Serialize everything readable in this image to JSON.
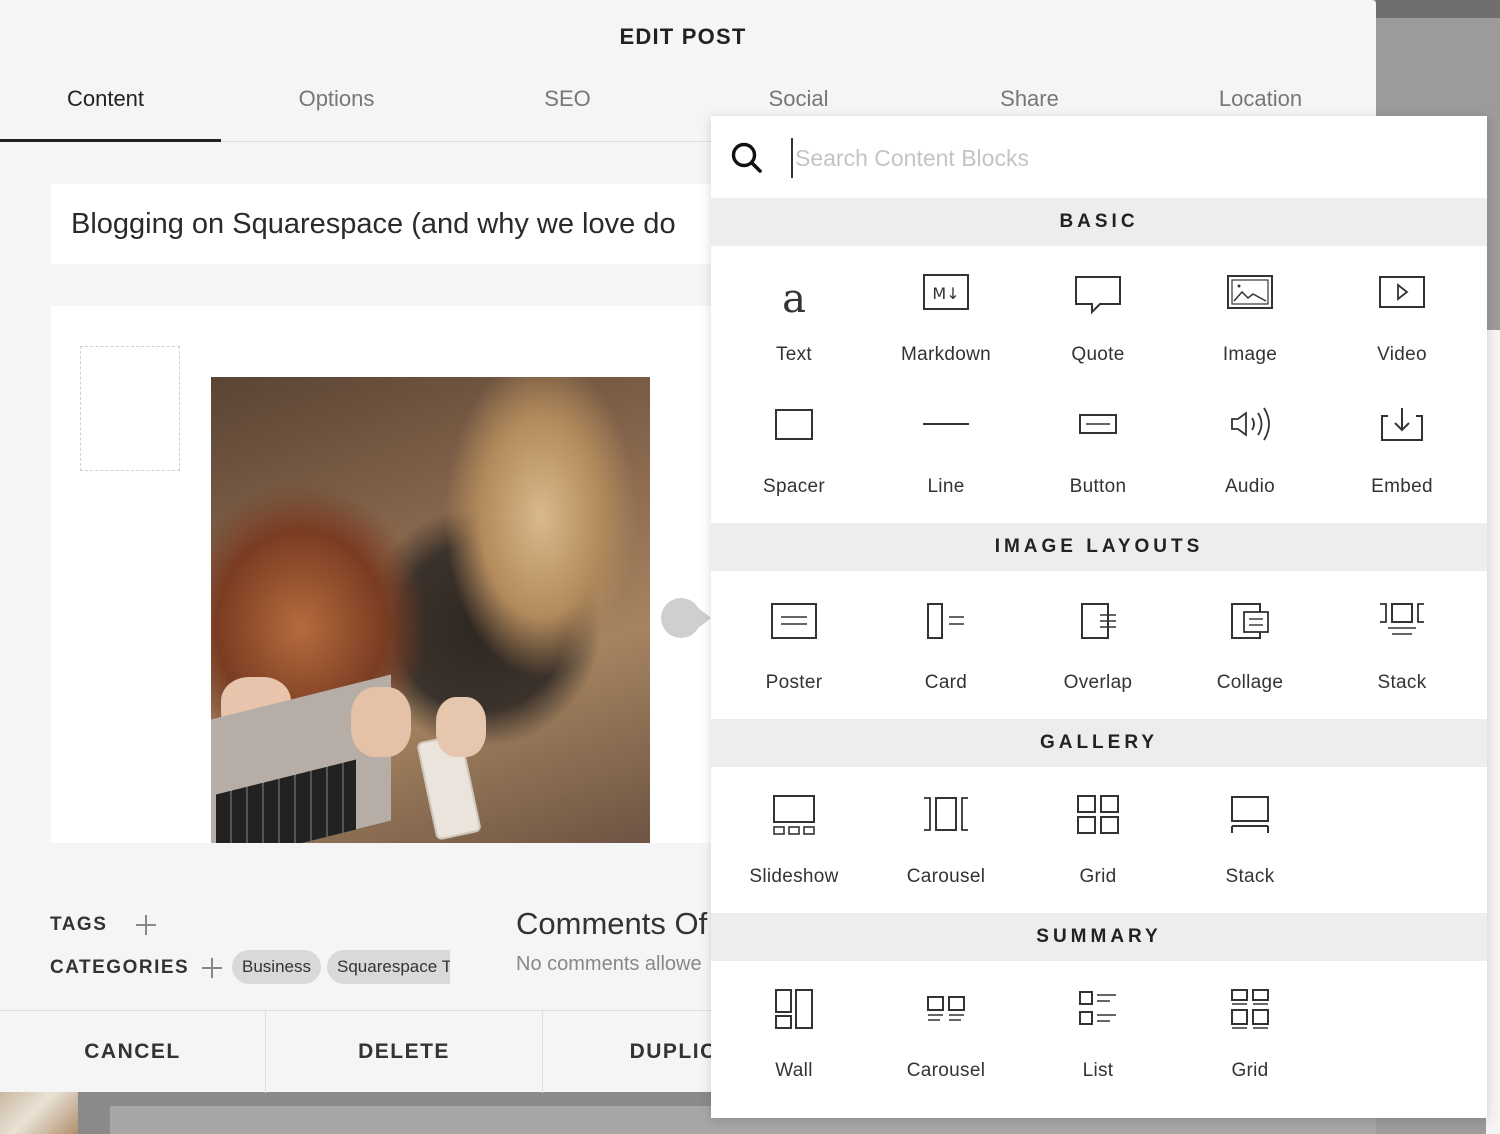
{
  "modal": {
    "title": "EDIT POST",
    "tabs": [
      {
        "label": "Content"
      },
      {
        "label": "Options"
      },
      {
        "label": "SEO"
      },
      {
        "label": "Social"
      },
      {
        "label": "Share"
      },
      {
        "label": "Location"
      }
    ],
    "active_tab": "Content",
    "post_title": "Blogging on Squarespace (and why we love do",
    "tags_label": "TAGS",
    "categories_label": "CATEGORIES",
    "categories": [
      "Business",
      "Squarespace T"
    ],
    "comments_title": "Comments Of",
    "comments_sub": "No comments allowe",
    "footer": {
      "cancel": "CANCEL",
      "delete": "DELETE",
      "duplicate": "DUPLICA"
    }
  },
  "panel": {
    "search_placeholder": "Search Content Blocks",
    "sections": [
      {
        "title": "BASIC",
        "blocks": [
          {
            "label": "Text",
            "icon": "text-icon"
          },
          {
            "label": "Markdown",
            "icon": "markdown-icon"
          },
          {
            "label": "Quote",
            "icon": "quote-icon"
          },
          {
            "label": "Image",
            "icon": "image-icon"
          },
          {
            "label": "Video",
            "icon": "video-icon"
          },
          {
            "label": "Spacer",
            "icon": "spacer-icon"
          },
          {
            "label": "Line",
            "icon": "line-icon"
          },
          {
            "label": "Button",
            "icon": "button-icon"
          },
          {
            "label": "Audio",
            "icon": "audio-icon"
          },
          {
            "label": "Embed",
            "icon": "embed-icon"
          }
        ]
      },
      {
        "title": "IMAGE LAYOUTS",
        "blocks": [
          {
            "label": "Poster",
            "icon": "poster-icon"
          },
          {
            "label": "Card",
            "icon": "card-icon"
          },
          {
            "label": "Overlap",
            "icon": "overlap-icon"
          },
          {
            "label": "Collage",
            "icon": "collage-icon"
          },
          {
            "label": "Stack",
            "icon": "stack-icon"
          }
        ]
      },
      {
        "title": "GALLERY",
        "blocks": [
          {
            "label": "Slideshow",
            "icon": "slideshow-icon"
          },
          {
            "label": "Carousel",
            "icon": "carousel-icon"
          },
          {
            "label": "Grid",
            "icon": "grid-icon"
          },
          {
            "label": "Stack",
            "icon": "gallery-stack-icon"
          }
        ]
      },
      {
        "title": "SUMMARY",
        "blocks": [
          {
            "label": "Wall",
            "icon": "wall-icon"
          },
          {
            "label": "Carousel",
            "icon": "summary-carousel-icon"
          },
          {
            "label": "List",
            "icon": "list-icon"
          },
          {
            "label": "Grid",
            "icon": "summary-grid-icon"
          }
        ]
      }
    ]
  }
}
